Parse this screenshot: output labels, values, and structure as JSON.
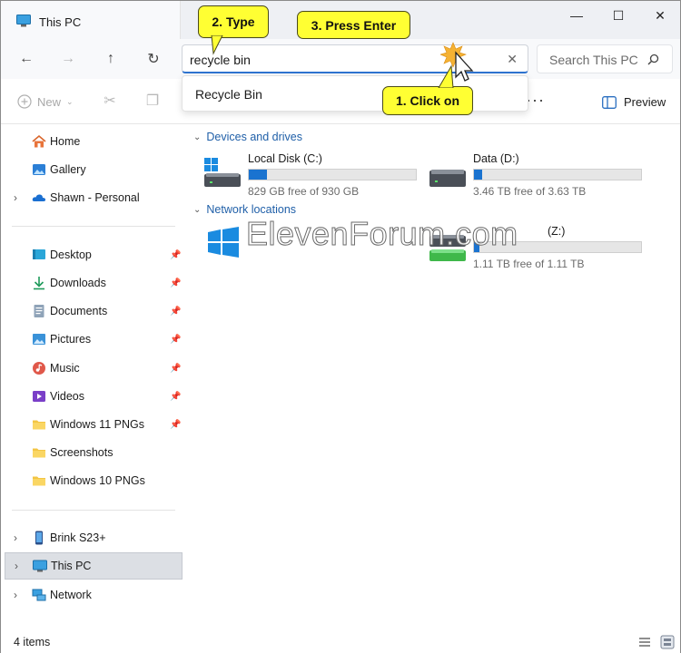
{
  "titlebar": {
    "tab_title": "This PC",
    "minimize": "—",
    "maximize": "☐",
    "close": "✕"
  },
  "navbar": {
    "back": "←",
    "forward": "→",
    "up": "↑",
    "refresh": "↻",
    "address_value": "recycle bin",
    "clear": "✕",
    "search_placeholder": "Search This PC"
  },
  "commandbar": {
    "new_label": "New",
    "more": "···",
    "preview_label": "Preview"
  },
  "dropdown": {
    "suggestion": "Recycle Bin"
  },
  "callouts": {
    "type": "2. Type",
    "enter": "3. Press Enter",
    "click": "1. Click on"
  },
  "sidebar": {
    "home": "Home",
    "gallery": "Gallery",
    "personal": "Shawn - Personal",
    "desktop": "Desktop",
    "downloads": "Downloads",
    "documents": "Documents",
    "pictures": "Pictures",
    "music": "Music",
    "videos": "Videos",
    "win11": "Windows 11 PNGs",
    "screenshots": "Screenshots",
    "win10": "Windows 10 PNGs",
    "phone": "Brink S23+",
    "thispc": "This PC",
    "network": "Network"
  },
  "content": {
    "devices_header": "Devices and drives",
    "network_header": "Network locations",
    "drives": [
      {
        "name": "Local Disk (C:)",
        "free": "829 GB free of 930 GB",
        "used_fraction": 0.11
      },
      {
        "name": "Data (D:)",
        "free": "3.46 TB free of 3.63 TB",
        "used_fraction": 0.05
      }
    ],
    "network_drive": {
      "name": "(Z:)",
      "free": "1.11 TB free of 1.11 TB",
      "used_fraction": 0.01
    },
    "watermark": "ElevenForum.com"
  },
  "status": {
    "items": "4 items"
  },
  "colors": {
    "accent": "#1a73d0",
    "callout": "#ffff33",
    "group_header": "#1f5fa8"
  }
}
